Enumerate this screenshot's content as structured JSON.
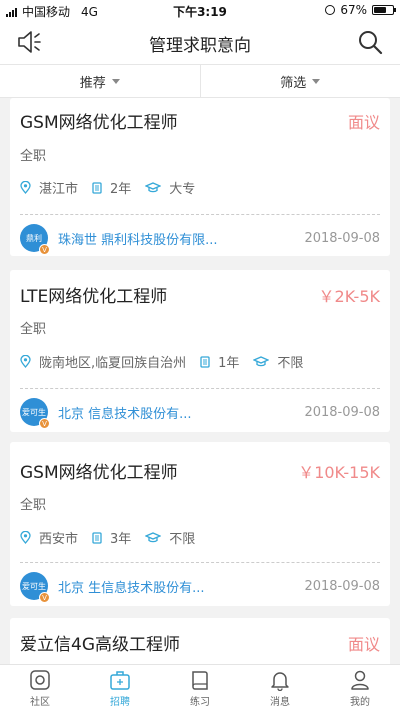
{
  "status": {
    "carrier": "中国移动",
    "network": "4G",
    "time": "下午3:19",
    "battery": "67%",
    "battery_level": 0.67
  },
  "nav": {
    "title": "管理求职意向",
    "left_icon": "speaker-icon",
    "right_icon": "search-icon"
  },
  "filters": [
    {
      "label": "推荐"
    },
    {
      "label": "筛选"
    }
  ],
  "jobs": [
    {
      "title": "GSM网络优化工程师",
      "salary": "面议",
      "type": "全职",
      "location": "湛江市",
      "experience": "2年",
      "education": "大专",
      "company_logo": "鼎利",
      "company": "珠海世   鼎利科技股份有限...",
      "date": "2018-09-08"
    },
    {
      "title": "LTE网络优化工程师",
      "salary": "￥2K-5K",
      "type": "全职",
      "location": "陇南地区,临夏回族自治州",
      "experience": "1年",
      "education": "不限",
      "company_logo": "爱可生",
      "company": "北京     信息技术股份有...",
      "date": "2018-09-08"
    },
    {
      "title": "GSM网络优化工程师",
      "salary": "￥10K-15K",
      "type": "全职",
      "location": "西安市",
      "experience": "3年",
      "education": "不限",
      "company_logo": "爱可生",
      "company": "北京    生信息技术股份有...",
      "date": "2018-09-08"
    },
    {
      "title": "爱立信4G高级工程师",
      "salary": "面议"
    }
  ],
  "tabs": [
    {
      "label": "社区",
      "icon": "community-icon",
      "active": false
    },
    {
      "label": "招聘",
      "icon": "recruit-icon",
      "active": true
    },
    {
      "label": "练习",
      "icon": "practice-icon",
      "active": false
    },
    {
      "label": "消息",
      "icon": "bell-icon",
      "active": false
    },
    {
      "label": "我的",
      "icon": "profile-icon",
      "active": false
    }
  ],
  "colors": {
    "accent": "#35a8d8",
    "salary": "#f08a8a",
    "company": "#2f8fd6",
    "badge": "#e8923a"
  }
}
